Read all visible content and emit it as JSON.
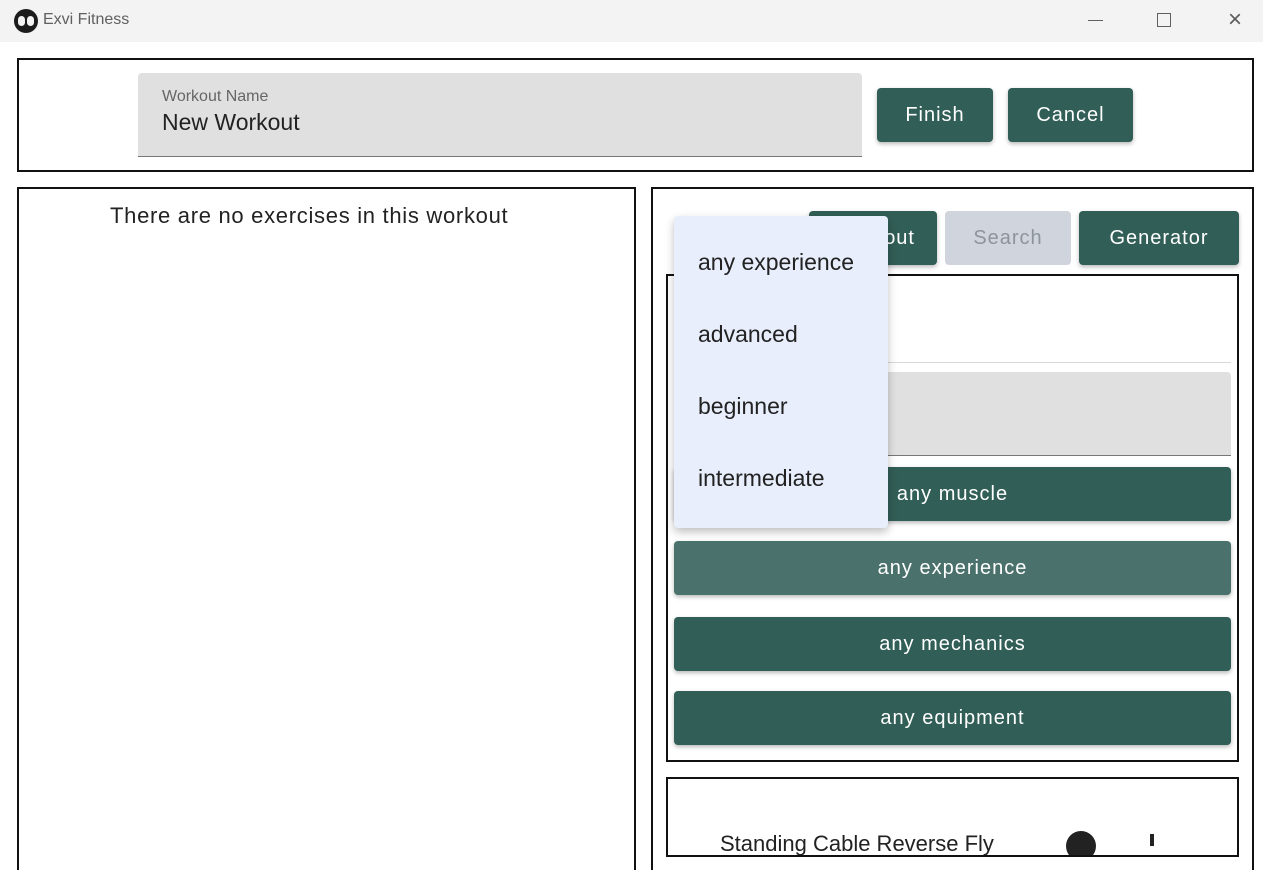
{
  "window": {
    "title": "Exvi Fitness",
    "minimize_label": "",
    "maximize_label": "",
    "close_label": "×"
  },
  "workout": {
    "name_label": "Workout Name",
    "name_value": "New Workout",
    "finish": "Finish",
    "cancel": "Cancel"
  },
  "left_panel": {
    "empty_message": "There are no exercises in this workout"
  },
  "tabs": {
    "about": "out",
    "search": "Search",
    "generator": "Generator"
  },
  "filters": {
    "muscle": "any muscle",
    "experience": "any experience",
    "mechanics": "any mechanics",
    "equipment": "any equipment"
  },
  "dropdown": {
    "items": [
      "any experience",
      "advanced",
      "beginner",
      "intermediate"
    ]
  },
  "results": [
    {
      "name": "Standing Cable Reverse Fly"
    }
  ],
  "colors": {
    "accent": "#315e56",
    "disabled_tab": "#cfd4dd",
    "menu_background": "#e8eefc"
  }
}
